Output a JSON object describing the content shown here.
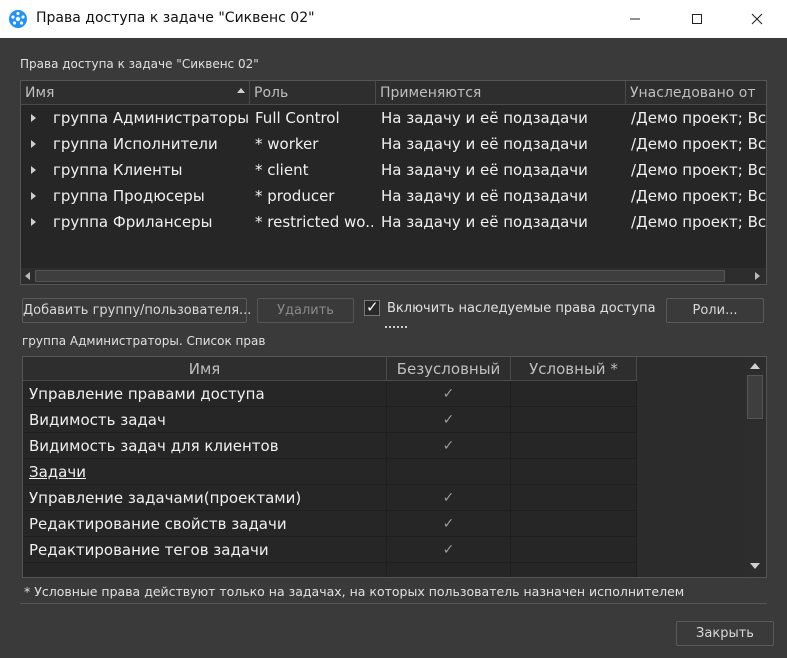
{
  "window": {
    "title": "Права доступа к задаче \"Сиквенс 02\"",
    "accent_color": "#1e90ff"
  },
  "header_label": "Права доступа к задаче \"Сиквенс 02\"",
  "access_table": {
    "columns": [
      "Имя",
      "Роль",
      "Применяются",
      "Унаследовано от"
    ],
    "rows": [
      {
        "name": "группа Администраторы",
        "role": "Full Control",
        "applies": "На задачу и её подзадачи",
        "inherited": "/Демо проект; Все"
      },
      {
        "name": "группа Исполнители",
        "role": "* worker",
        "applies": "На задачу и её подзадачи",
        "inherited": "/Демо проект; Все"
      },
      {
        "name": "группа Клиенты",
        "role": "* client",
        "applies": "На задачу и её подзадачи",
        "inherited": "/Демо проект; Все"
      },
      {
        "name": "группа Продюсеры",
        "role": "* producer",
        "applies": "На задачу и её подзадачи",
        "inherited": "/Демо проект; Все"
      },
      {
        "name": "группа Фрилансеры",
        "role": "* restricted wo...",
        "applies": "На задачу и её подзадачи",
        "inherited": "/Демо проект; Все"
      }
    ]
  },
  "buttons": {
    "add": "Добавить группу/пользователя...",
    "delete": "Удалить",
    "roles": "Роли...",
    "close": "Закрыть"
  },
  "inherit_checkbox": {
    "label": "Включить наследуемые права доступа",
    "checked": true,
    "mark": "✓"
  },
  "rights_label": "группа Администраторы. Список прав",
  "rights_table": {
    "columns": [
      "Имя",
      "Безусловный",
      "Условный *"
    ],
    "check_glyph": "✓",
    "rows": [
      {
        "name": "Управление правами доступа",
        "section": false,
        "unconditional": true,
        "conditional": false
      },
      {
        "name": "Видимость задач",
        "section": false,
        "unconditional": true,
        "conditional": false
      },
      {
        "name": "Видимость задач для клиентов",
        "section": false,
        "unconditional": true,
        "conditional": false
      },
      {
        "name": "Задачи",
        "section": true,
        "unconditional": false,
        "conditional": false
      },
      {
        "name": "Управление задачами(проектами)",
        "section": false,
        "unconditional": true,
        "conditional": false
      },
      {
        "name": "Редактирование свойств задачи",
        "section": false,
        "unconditional": true,
        "conditional": false
      },
      {
        "name": "Редактирование тегов задачи",
        "section": false,
        "unconditional": true,
        "conditional": false
      }
    ]
  },
  "footnote": "* Условные права действуют только на задачах, на которых пользователь назначен исполнителем"
}
